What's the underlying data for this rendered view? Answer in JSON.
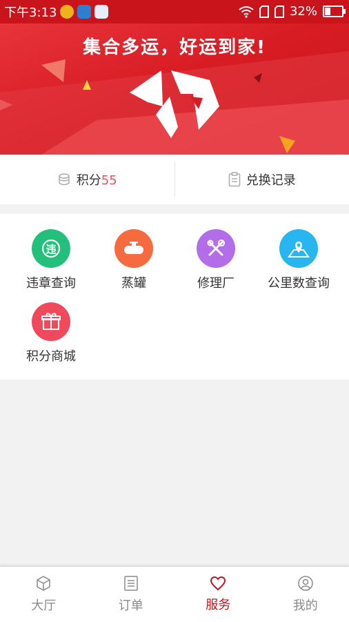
{
  "status_bar": {
    "time": "下午3:13",
    "battery": "32%",
    "battery_level": 0.32
  },
  "banner": {
    "slogan": "集合多运，好运到家!"
  },
  "points": {
    "label": "积分",
    "value": "55",
    "exchange_label": "兑换记录"
  },
  "services": [
    {
      "label": "违章查询",
      "icon": "violation-icon",
      "color": "#22c07a"
    },
    {
      "label": "蒸罐",
      "icon": "tank-icon",
      "color": "#f56a3e"
    },
    {
      "label": "修理厂",
      "icon": "wrench-icon",
      "color": "#b36de8"
    },
    {
      "label": "公里数查询",
      "icon": "map-pin-icon",
      "color": "#27b6f0"
    },
    {
      "label": "积分商城",
      "icon": "gift-icon",
      "color": "#f0495c"
    }
  ],
  "tabs": [
    {
      "label": "大厅",
      "icon": "box-icon",
      "active": false
    },
    {
      "label": "订单",
      "icon": "document-icon",
      "active": false
    },
    {
      "label": "服务",
      "icon": "heart-icon",
      "active": true
    },
    {
      "label": "我的",
      "icon": "user-icon",
      "active": false
    }
  ],
  "colors": {
    "brand": "#c8141a",
    "points_value": "#e35656"
  }
}
